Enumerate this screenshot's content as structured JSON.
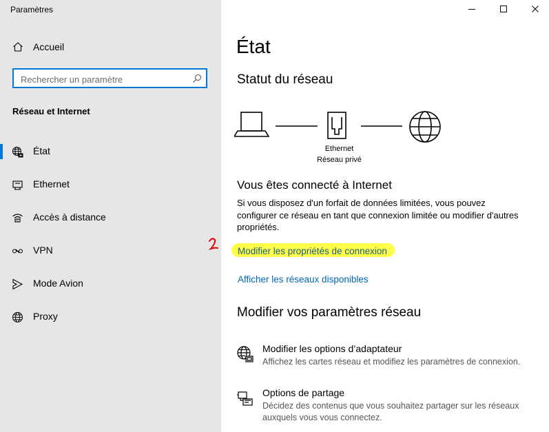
{
  "window": {
    "title": "Paramètres",
    "controls": [
      "minimize-icon",
      "maximize-icon",
      "close-icon"
    ]
  },
  "sidebar": {
    "home_label": "Accueil",
    "search": {
      "placeholder": "Rechercher un paramètre"
    },
    "section_title": "Réseau et Internet",
    "items": [
      {
        "label": "État",
        "icon": "globe-network-icon",
        "active": true
      },
      {
        "label": "Ethernet",
        "icon": "ethernet-icon"
      },
      {
        "label": "Accès à distance",
        "icon": "dialup-icon"
      },
      {
        "label": "VPN",
        "icon": "vpn-icon"
      },
      {
        "label": "Mode Avion",
        "icon": "airplane-icon"
      },
      {
        "label": "Proxy",
        "icon": "globe-icon"
      }
    ]
  },
  "main": {
    "title": "État",
    "network_status_heading": "Statut du réseau",
    "diagram": {
      "adapter_name": "Ethernet",
      "network_profile": "Réseau privé"
    },
    "connected_heading": "Vous êtes connecté à Internet",
    "connected_desc": "Si vous disposez d'un forfait de données limitées, vous pouvez configurer ce réseau en tant que connexion limitée ou modifier d'autres propriétés.",
    "link_properties": "Modifier les propriétés de connexion",
    "link_networks": "Afficher les réseaux disponibles",
    "change_settings_heading": "Modifier vos paramètres réseau",
    "options": [
      {
        "title": "Modifier les options d’adaptateur",
        "desc": "Affichez les cartes réseau et modifiez les paramètres de connexion.",
        "icon": "adapter-icon"
      },
      {
        "title": "Options de partage",
        "desc": "Décidez des contenus que vous souhaitez partager sur les réseaux auxquels vous vous connectez.",
        "icon": "sharing-icon"
      }
    ]
  },
  "annotation": {
    "mark": "2",
    "highlight_color": "#ffff3b",
    "mark_color": "#e00000"
  },
  "colors": {
    "accent": "#0078d7",
    "link": "#0067b8",
    "sidebar_bg": "#e6e6e6"
  }
}
